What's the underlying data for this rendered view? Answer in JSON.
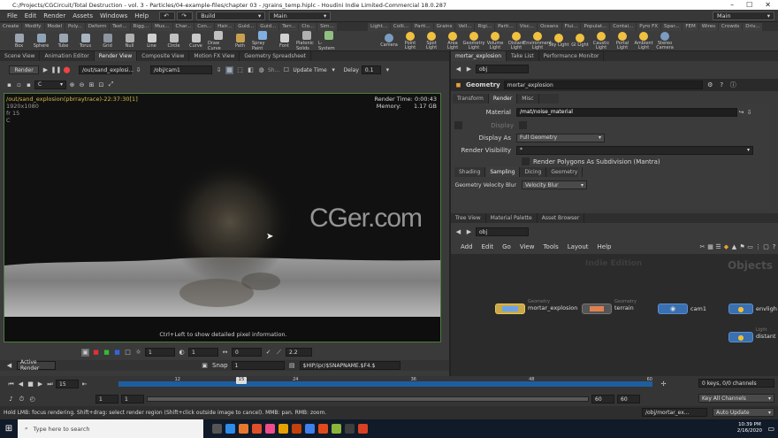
{
  "window": {
    "title": "C:/Projects/CGCircuit/Total Destruction - vol. 3 - Particles/04-example-files/chapter 03 - /grains_temp.hiplc - Houdini Indie Limited-Commercial 18.0.287"
  },
  "menu": [
    "File",
    "Edit",
    "Render",
    "Assets",
    "Windows",
    "Help"
  ],
  "desktop": {
    "build": "Build",
    "main": "Main",
    "main_right": "Main"
  },
  "shelf_tabs_left": [
    "Create",
    "Modify",
    "Model",
    "Poly...",
    "Deform",
    "Text...",
    "Rigg...",
    "Mus...",
    "Char...",
    "Con...",
    "Hair...",
    "Guid...",
    "Guid...",
    "Terr...",
    "Clo...",
    "Sim..."
  ],
  "shelf_tabs_right": [
    "Light...",
    "Colli...",
    "Parti...",
    "Grains",
    "Vell...",
    "Rigi...",
    "Parti...",
    "Visc...",
    "Oceans",
    "Flui...",
    "Populat...",
    "Contai...",
    "Pyro FX",
    "Spar...",
    "FEM",
    "Wires",
    "Crowds",
    "Driv..."
  ],
  "shelf_tools": [
    "Box",
    "Sphere",
    "Tube",
    "Torus",
    "Grid",
    "Null",
    "Line",
    "Circle",
    "Curve",
    "Draw Curve",
    "Path",
    "Spray Paint",
    "Font",
    "Platonic Solids",
    "L-System"
  ],
  "light_tools": [
    "Camera",
    "Point Light",
    "Spot Light",
    "Area Light",
    "Geometry Light",
    "Volume Light",
    "Distant Light",
    "Environment Light",
    "Sky Light",
    "GI Light",
    "Caustic Light",
    "Portal Light",
    "Ambient Light",
    "Stereo Camera"
  ],
  "left_tabs": [
    "Scene View",
    "Animation Editor",
    "Render View",
    "Composite View",
    "Motion FX View",
    "Geometry Spreadsheet"
  ],
  "render_bar": {
    "render": "Render",
    "out_path": "/out/sand_explosi...",
    "obj_path": "/obj/cam1",
    "update": "Update Time",
    "delay_label": "Delay",
    "delay": "0.1",
    "sh": "Sh...",
    "channel": "C"
  },
  "viewport": {
    "title": "/out/sand_explosion(pbrraytrace)-22:37:30[1]",
    "res": "1920x1080",
    "fr": "fr 15",
    "c": "C",
    "render_time_label": "Render Time:",
    "render_time": "0:00:43",
    "memory_label": "Memory:",
    "memory": "1.17 GB",
    "watermark": "CGer.com",
    "hint": "Ctrl+Left to show detailed pixel information."
  },
  "vp_bottom": {
    "v1": "1",
    "v2": "1",
    "v3": "0",
    "v4": "2.2"
  },
  "snap_bar": {
    "active": "Active Render",
    "snap": "Snap",
    "snap_val": "1",
    "path": "$HIP/ipr/$SNAPNAME.$F4.$"
  },
  "right_tabs": [
    "mortar_explosion",
    "Take List",
    "Performance Monitor"
  ],
  "param": {
    "obj": "obj",
    "node_type": "Geometry",
    "node_name": "mortar_explosion",
    "tabs": [
      "Transform",
      "Render",
      "Misc"
    ],
    "material_label": "Material",
    "material": "/mat/noise_material",
    "display_label": "Display",
    "display_as_label": "Display As",
    "display_as": "Full Geometry",
    "render_vis_label": "Render Visibility",
    "render_vis": "*",
    "poly_sub": "Render Polygons As Subdivision (Mantra)",
    "subtabs": [
      "Shading",
      "Sampling",
      "Dicing",
      "Geometry"
    ],
    "vel_label": "Geometry Velocity Blur",
    "vel": "Velocity Blur"
  },
  "net_tabs": [
    "Tree View",
    "Material Palette",
    "Asset Browser"
  ],
  "network": {
    "obj": "obj",
    "menu": [
      "Add",
      "Edit",
      "Go",
      "View",
      "Tools",
      "Layout",
      "Help"
    ],
    "indie": "Indie Edition",
    "objects": "Objects",
    "nodes": [
      {
        "type": "Geometry",
        "name": "mortar_explosion"
      },
      {
        "type": "Geometry",
        "name": "terrain"
      },
      {
        "type": "",
        "name": "cam1"
      },
      {
        "type": "",
        "name": "envligh"
      },
      {
        "type": "Light",
        "name": "distant"
      }
    ]
  },
  "timeline": {
    "frame": "15",
    "ticks": [
      "",
      "12",
      "",
      "24",
      "",
      "36",
      "",
      "48",
      "",
      "60"
    ],
    "start": "1",
    "start2": "1",
    "end": "60",
    "end2": "60",
    "keys": "0 keys, 0/0 channels",
    "key_all": "Key All Channels"
  },
  "status": {
    "text": "Hold LMB: focus rendering. Shift+drag: select render region (Shift+click outside image to cancel). MMB: pan. RMB: zoom.",
    "path": "/obj/mortar_ex...",
    "auto": "Auto Update"
  },
  "taskbar": {
    "search": "Type here to search",
    "time": "10:39 PM",
    "date": "2/16/2020"
  },
  "colors": {
    "accent": "#e8a23a",
    "vp_border": "#4c7d3e",
    "timeline": "#1d5ea0"
  }
}
